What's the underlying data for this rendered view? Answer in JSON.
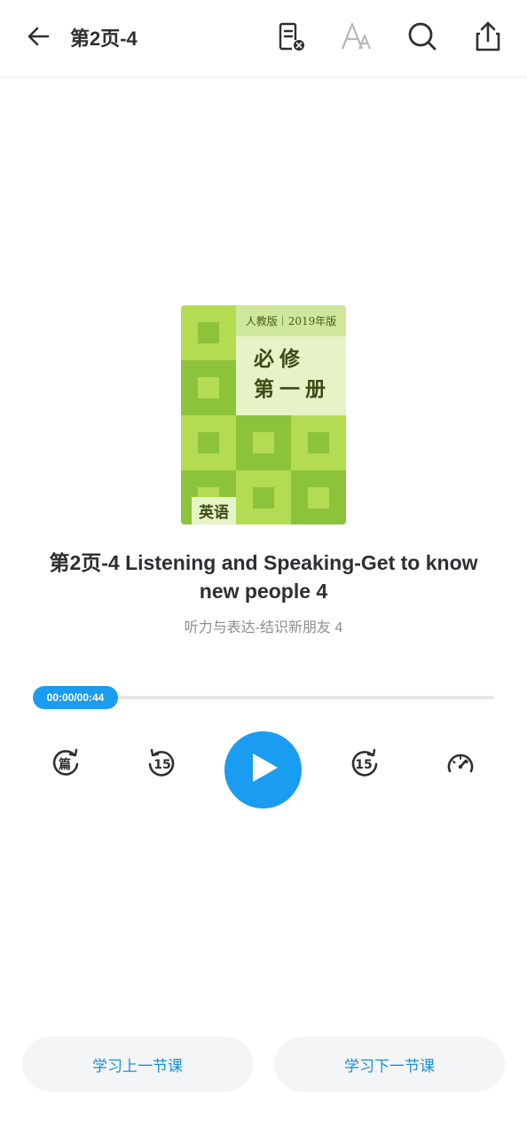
{
  "header": {
    "title": "第2页-4",
    "icons": [
      "back-arrow-icon",
      "document-close-icon",
      "font-size-icon",
      "search-icon",
      "share-icon"
    ]
  },
  "cover": {
    "edition": "人教版｜2019年版",
    "title_line1": "必修",
    "title_line2": "第一册",
    "subject": "英语",
    "colors": {
      "dark": "#8cc33a",
      "light": "#b3dc52",
      "panel": "#e6f3c7"
    }
  },
  "lesson": {
    "title": "第2页-4 Listening and Speaking-Get to know new people 4",
    "subtitle": "听力与表达-结识新朋友 4"
  },
  "player": {
    "time_display": "00:00/00:44",
    "progress": 0,
    "controls": {
      "chapter_label": "篇",
      "rewind_label": "15",
      "forward_label": "15"
    },
    "accent": "#1a9cf0"
  },
  "footer": {
    "prev_label": "学习上一节课",
    "next_label": "学习下一节课"
  }
}
